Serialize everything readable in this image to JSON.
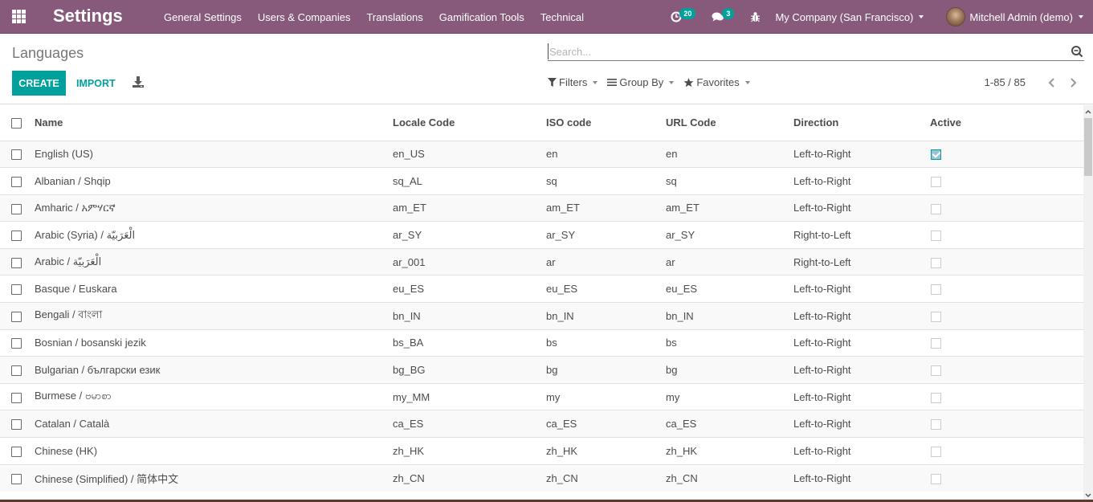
{
  "navbar": {
    "app_title": "Settings",
    "menu": [
      "General Settings",
      "Users & Companies",
      "Translations",
      "Gamification Tools",
      "Technical"
    ],
    "activities_count": "20",
    "messages_count": "3",
    "company": "My Company (San Francisco)",
    "user": "Mitchell Admin (demo)",
    "brand_color": "#875a7b",
    "accent_color": "#00a09d"
  },
  "control_panel": {
    "breadcrumb": "Languages",
    "create_label": "CREATE",
    "import_label": "IMPORT",
    "search_placeholder": "Search...",
    "search_value": "",
    "filters_label": "Filters",
    "group_by_label": "Group By",
    "favorites_label": "Favorites",
    "pager_value": "1-85 / 85"
  },
  "table": {
    "columns": [
      "Name",
      "Locale Code",
      "ISO code",
      "URL Code",
      "Direction",
      "Active"
    ],
    "rows": [
      {
        "name": "English (US)",
        "locale": "en_US",
        "iso": "en",
        "url": "en",
        "direction": "Left-to-Right",
        "active": true
      },
      {
        "name": "Albanian / Shqip",
        "locale": "sq_AL",
        "iso": "sq",
        "url": "sq",
        "direction": "Left-to-Right",
        "active": false
      },
      {
        "name": "Amharic / አምሃርኛ",
        "locale": "am_ET",
        "iso": "am_ET",
        "url": "am_ET",
        "direction": "Left-to-Right",
        "active": false
      },
      {
        "name": "Arabic (Syria) / الْعَرَبيّة",
        "locale": "ar_SY",
        "iso": "ar_SY",
        "url": "ar_SY",
        "direction": "Right-to-Left",
        "active": false
      },
      {
        "name": "Arabic / الْعَرَبيّة",
        "locale": "ar_001",
        "iso": "ar",
        "url": "ar",
        "direction": "Right-to-Left",
        "active": false
      },
      {
        "name": "Basque / Euskara",
        "locale": "eu_ES",
        "iso": "eu_ES",
        "url": "eu_ES",
        "direction": "Left-to-Right",
        "active": false
      },
      {
        "name": "Bengali / বাংলা",
        "locale": "bn_IN",
        "iso": "bn_IN",
        "url": "bn_IN",
        "direction": "Left-to-Right",
        "active": false
      },
      {
        "name": "Bosnian / bosanski jezik",
        "locale": "bs_BA",
        "iso": "bs",
        "url": "bs",
        "direction": "Left-to-Right",
        "active": false
      },
      {
        "name": "Bulgarian / български език",
        "locale": "bg_BG",
        "iso": "bg",
        "url": "bg",
        "direction": "Left-to-Right",
        "active": false
      },
      {
        "name": "Burmese / ဗမာစာ",
        "locale": "my_MM",
        "iso": "my",
        "url": "my",
        "direction": "Left-to-Right",
        "active": false
      },
      {
        "name": "Catalan / Català",
        "locale": "ca_ES",
        "iso": "ca_ES",
        "url": "ca_ES",
        "direction": "Left-to-Right",
        "active": false
      },
      {
        "name": "Chinese (HK)",
        "locale": "zh_HK",
        "iso": "zh_HK",
        "url": "zh_HK",
        "direction": "Left-to-Right",
        "active": false
      },
      {
        "name": "Chinese (Simplified) / 简体中文",
        "locale": "zh_CN",
        "iso": "zh_CN",
        "url": "zh_CN",
        "direction": "Left-to-Right",
        "active": false
      }
    ]
  }
}
